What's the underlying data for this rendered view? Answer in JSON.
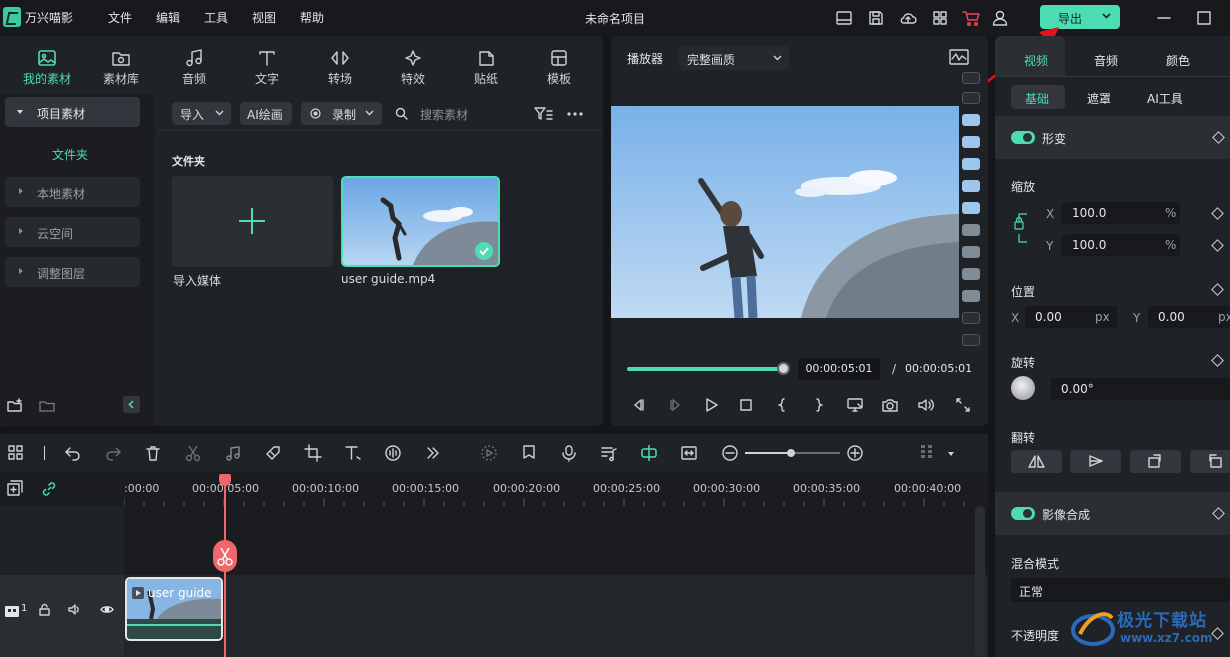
{
  "app": {
    "name": "万兴喵影",
    "project_title": "未命名项目"
  },
  "menu": [
    "文件",
    "编辑",
    "工具",
    "视图",
    "帮助"
  ],
  "export_button": {
    "label": "导出"
  },
  "toolbar_tabs": [
    "我的素材",
    "素材库",
    "音频",
    "文字",
    "转场",
    "特效",
    "贴纸",
    "模板"
  ],
  "sidebar": {
    "project_media": "项目素材",
    "folder": "文件夹",
    "items": [
      "本地素材",
      "云空间",
      "调整图层"
    ]
  },
  "media_toolbar": {
    "import": "导入",
    "ai_paint": "AI绘画",
    "record": "录制",
    "search_placeholder": "搜索素材"
  },
  "media_area": {
    "section_title": "文件夹",
    "import_tile_label": "导入媒体",
    "clip_label": "user guide.mp4"
  },
  "player": {
    "label": "播放器",
    "quality": "完整画质",
    "current_time": "00:00:05:01",
    "separator": "/",
    "total_time": "00:00:05:01",
    "progress": 1.0
  },
  "right_panel": {
    "tabs": [
      "视频",
      "音频",
      "颜色"
    ],
    "subtabs": [
      "基础",
      "遮罩",
      "AI工具"
    ],
    "transform": "形变",
    "scale_label": "缩放",
    "scale_x": {
      "axis": "X",
      "value": "100.0",
      "unit": "%"
    },
    "scale_y": {
      "axis": "Y",
      "value": "100.0",
      "unit": "%"
    },
    "position_label": "位置",
    "pos_x": {
      "axis": "X",
      "value": "0.00",
      "unit": "px"
    },
    "pos_y": {
      "axis": "Y",
      "value": "0.00",
      "unit": "px"
    },
    "rotation_label": "旋转",
    "rotation_value": "0.00°",
    "flip_label": "翻转",
    "compositing": "影像合成",
    "blend_label": "混合模式",
    "blend_value": "正常",
    "opacity_label": "不透明度"
  },
  "timeline": {
    "ticks": [
      ":00:00",
      "00:00:05:00",
      "00:00:10:00",
      "00:00:15:00",
      "00:00:20:00",
      "00:00:25:00",
      "00:00:30:00",
      "00:00:35:00",
      "00:00:40:00"
    ],
    "track_number": "1",
    "clip_title": "user guide"
  },
  "watermark": {
    "title": "极光下载站",
    "url": "www.xz7.com"
  },
  "colors": {
    "accent": "#4ddcb3",
    "playhead": "#f0666a",
    "annotation_arrow": "#e0141e"
  }
}
